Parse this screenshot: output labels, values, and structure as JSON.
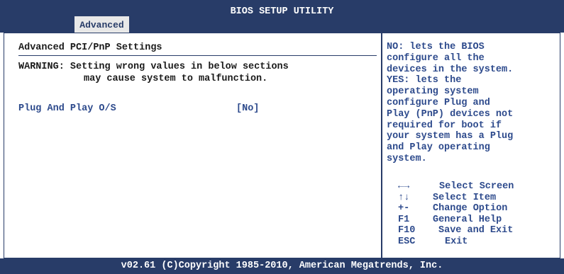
{
  "header": {
    "title": "BIOS SETUP UTILITY",
    "active_tab": "Advanced"
  },
  "main": {
    "heading": "Advanced PCI/PnP Settings",
    "warning_line1": "WARNING: Setting wrong values in below sections",
    "warning_line2": "may cause system to malfunction.",
    "options": [
      {
        "label": "Plug And Play O/S",
        "value": "[No]"
      }
    ]
  },
  "help": {
    "lines": [
      "NO: lets the BIOS",
      "configure all the",
      "devices in the system.",
      "YES: lets the",
      "operating system",
      "configure Plug and",
      "Play (PnP) devices not",
      "required for boot if",
      "your system has a Plug",
      "and Play operating",
      "system."
    ],
    "keys": [
      {
        "key": "←→",
        "desc": "Select Screen"
      },
      {
        "key": "↑↓",
        "desc": "Select Item"
      },
      {
        "key": "+-",
        "desc": "Change Option"
      },
      {
        "key": "F1",
        "desc": "General Help"
      },
      {
        "key": "F10",
        "desc": "Save and Exit"
      },
      {
        "key": "ESC",
        "desc": "Exit"
      }
    ]
  },
  "footer": {
    "copyright": "v02.61 (C)Copyright 1985-2010, American Megatrends, Inc."
  },
  "colors": {
    "bar": "#283c68",
    "accent_text": "#2d4a8c",
    "tab_bg": "#e8e8e8"
  }
}
